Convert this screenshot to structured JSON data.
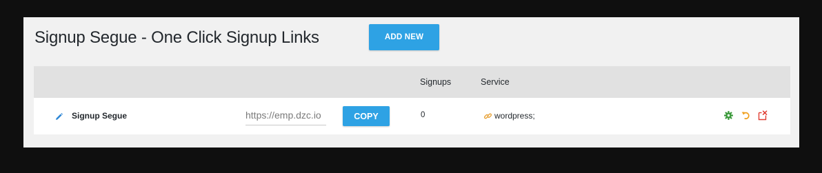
{
  "header": {
    "title": "Signup Segue - One Click Signup Links",
    "add_new_label": "ADD NEW"
  },
  "table": {
    "columns": [
      {
        "key": "name",
        "label": ""
      },
      {
        "key": "link",
        "label": ""
      },
      {
        "key": "copy",
        "label": ""
      },
      {
        "key": "signups",
        "label": "Signups"
      },
      {
        "key": "service",
        "label": "Service"
      },
      {
        "key": "actions",
        "label": ""
      }
    ],
    "rows": [
      {
        "name": "Signup Segue",
        "link_value": "https://emp.dzc.io",
        "copy_label": "COPY",
        "signups": "0",
        "service": "wordpress;"
      }
    ]
  },
  "icons": {
    "edit": "pencil-icon",
    "service": "link-icon",
    "settings": "gear-icon",
    "reset": "undo-icon",
    "delete": "delete-icon"
  },
  "colors": {
    "accent": "#2ea2e4",
    "pencil": "#2e87d6",
    "link_icon": "#e8a33a",
    "gear": "#3c9a3c",
    "undo": "#f0a020",
    "delete": "#e03c31"
  }
}
